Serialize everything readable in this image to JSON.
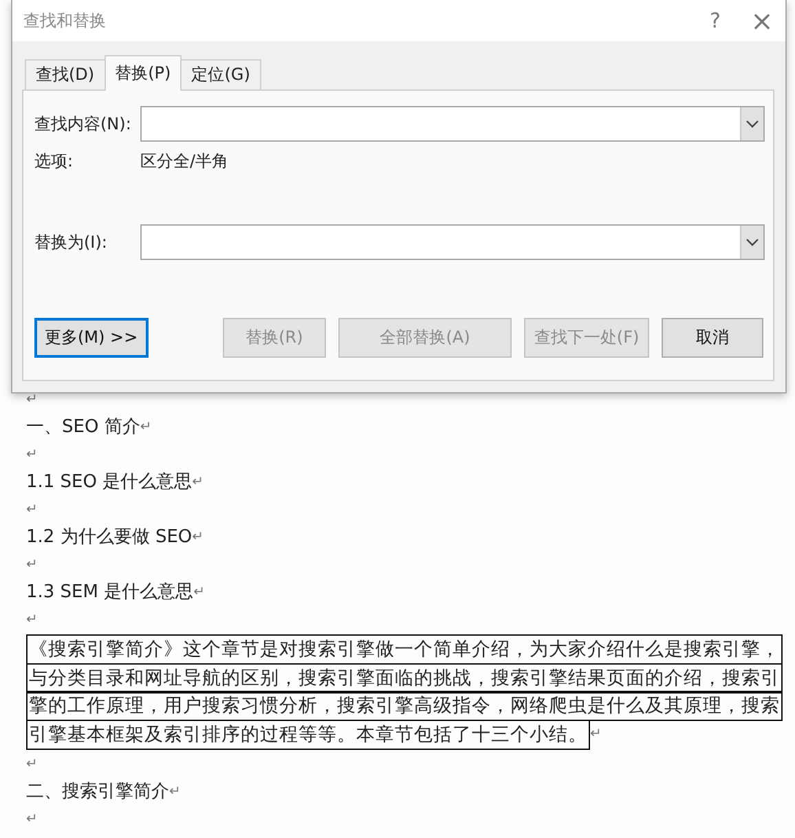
{
  "dialog": {
    "title": "查找和替换",
    "help": "?",
    "close": "×",
    "tabs": [
      {
        "label": "查找(D)",
        "selected": false
      },
      {
        "label": "替换(P)",
        "selected": true
      },
      {
        "label": "定位(G)",
        "selected": false
      }
    ],
    "find_field": {
      "label": "查找内容(N):"
    },
    "options": {
      "label": "选项:",
      "value": "区分全/半角"
    },
    "replace_field": {
      "label": "替换为(I):"
    },
    "buttons": [
      {
        "label": "更多(M)",
        "suffix": ">>",
        "disabled": false,
        "focused": true
      },
      {
        "label": "替换(R)",
        "disabled": true,
        "focused": false
      },
      {
        "label": "全部替换(A)",
        "disabled": true,
        "focused": false
      },
      {
        "label": "查找下一处(F)",
        "disabled": true,
        "focused": false
      },
      {
        "label": "取消",
        "disabled": false,
        "focused": false
      }
    ]
  },
  "document": {
    "paragraphs": [
      {
        "kind": "empty",
        "mark": "↵"
      },
      {
        "kind": "text",
        "text": "一、SEO 简介",
        "mark": "↵"
      },
      {
        "kind": "empty",
        "mark": "↵"
      },
      {
        "kind": "text",
        "text": "1.1 SEO 是什么意思",
        "mark": "↵"
      },
      {
        "kind": "empty",
        "mark": "↵"
      },
      {
        "kind": "text",
        "text": "1.2  为什么要做 SEO",
        "mark": "↵"
      },
      {
        "kind": "empty",
        "mark": "↵"
      },
      {
        "kind": "text",
        "text": "1.3 SEM 是什么意思",
        "mark": "↵"
      },
      {
        "kind": "empty",
        "mark": "↵"
      },
      {
        "kind": "boxed",
        "lines": [
          "《搜索引擎简介》这个章节是对搜索引擎做一个简单介绍，为大家介绍什么是搜索引擎，",
          "与分类目录和网址导航的区别，搜索引擎面临的挑战，搜索引擎结果页面的介绍，搜索引",
          "擎的工作原理，用户搜索习惯分析，搜索引擎高级指令，网络爬虫是什么及其原理，搜索",
          "引擎基本框架及索引排序的过程等等。本章节包括了十三个小结。"
        ],
        "mark": "↵"
      },
      {
        "kind": "empty",
        "mark": "↵"
      },
      {
        "kind": "text",
        "text": "二、搜索引擎简介",
        "mark": "↵"
      },
      {
        "kind": "empty",
        "mark": "↵"
      }
    ]
  }
}
